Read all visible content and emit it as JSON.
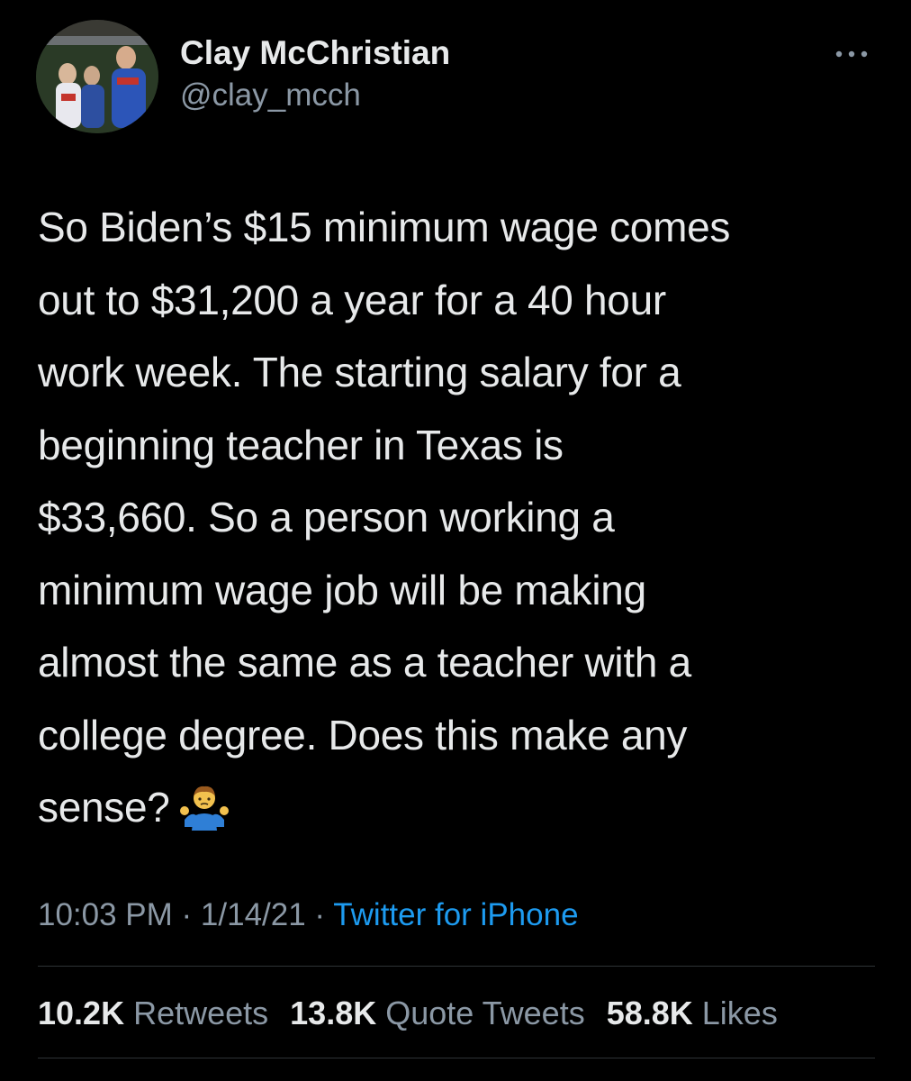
{
  "author": {
    "display_name": "Clay McChristian",
    "handle": "@clay_mcch"
  },
  "tweet": {
    "lines": [
      "So Biden’s $15 minimum wage comes",
      "out to $31,200 a year for a 40 hour",
      "work week. The starting salary for a",
      "beginning teacher in Texas is",
      "$33,660. So a person working a",
      "minimum wage job will be making",
      "almost the same as a teacher with a",
      "college degree. Does this make any",
      "sense?"
    ],
    "emoji": "man-shrugging-icon"
  },
  "meta": {
    "time": "10:03 PM",
    "separator": " · ",
    "date": "1/14/21",
    "source": "Twitter for iPhone"
  },
  "stats": {
    "retweets_count": "10.2K",
    "retweets_label": "Retweets",
    "quotes_count": "13.8K",
    "quotes_label": "Quote Tweets",
    "likes_count": "58.8K",
    "likes_label": "Likes"
  },
  "colors": {
    "background": "#000000",
    "text": "#e7e9ea",
    "secondary": "#8b98a5",
    "link": "#1d9bf0",
    "divider": "#2f3336"
  }
}
